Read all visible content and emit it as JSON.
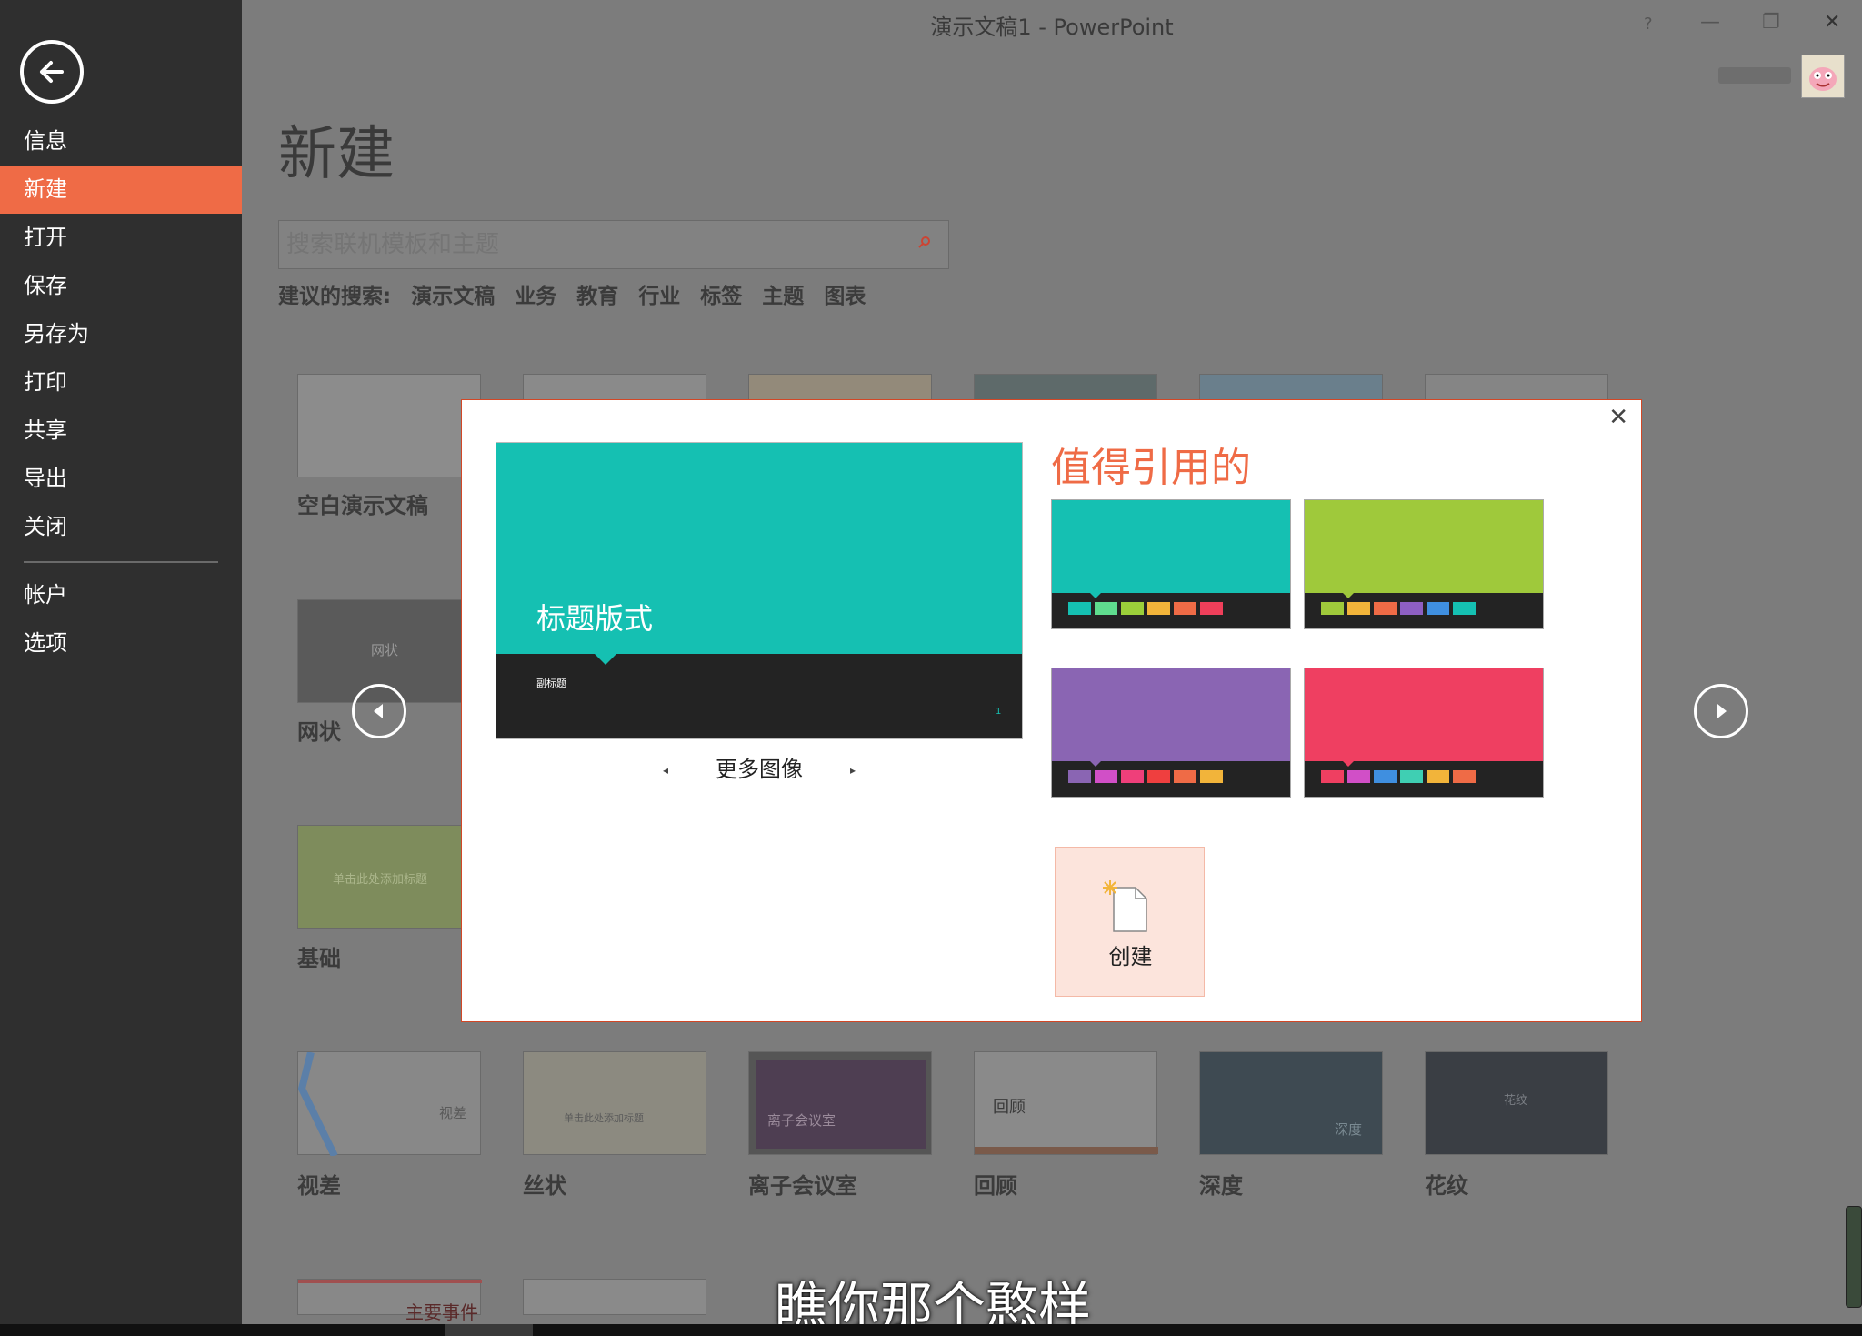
{
  "window": {
    "title": "演示文稿1 - PowerPoint",
    "help": "?",
    "minimize": "—",
    "maximize": "❐",
    "close": "✕"
  },
  "sidebar": {
    "items": [
      {
        "label": "信息"
      },
      {
        "label": "新建"
      },
      {
        "label": "打开"
      },
      {
        "label": "保存"
      },
      {
        "label": "另存为"
      },
      {
        "label": "打印"
      },
      {
        "label": "共享"
      },
      {
        "label": "导出"
      },
      {
        "label": "关闭"
      },
      {
        "label": "帐户"
      },
      {
        "label": "选项"
      }
    ],
    "active_index": 1
  },
  "main": {
    "heading": "新建",
    "search": {
      "placeholder": "搜索联机模板和主题"
    },
    "suggested": {
      "label": "建议的搜索:",
      "items": [
        "演示文稿",
        "业务",
        "教育",
        "行业",
        "标签",
        "主题",
        "图表"
      ]
    },
    "templates": {
      "blank": "空白演示文稿",
      "mesh": "网状",
      "mesh_inner": "网状",
      "basis": "基础",
      "basis_inner": "单击此处添加标题",
      "parallax": "视差",
      "parallax_inner": "视差",
      "wisp": "丝状",
      "wisp_inner": "单击此处添加标题",
      "ion_boardroom": "离子会议室",
      "ion_boardroom_inner": "离子会议室",
      "retrospect": "回顾",
      "retrospect_inner": "回顾",
      "depth": "深度",
      "depth_inner": "深度",
      "vapor": "花纹",
      "vapor_inner": "花纹",
      "partial_inner": "主要事件"
    }
  },
  "modal": {
    "close": "✕",
    "preview": {
      "title": "标题版式",
      "subtitle": "副标题",
      "page_number": "1"
    },
    "more_images": "更多图像",
    "prev_arrow": "◂",
    "next_arrow": "▸",
    "heading": "值得引用的",
    "variants": [
      {
        "color": "#15c0b2",
        "swatches": [
          "#15c0b2",
          "#5fdc8e",
          "#9bcf3a",
          "#f2b43a",
          "#ef6b46",
          "#ef3f5a"
        ]
      },
      {
        "color": "#9fc93b",
        "swatches": [
          "#9fc93b",
          "#f2b43a",
          "#ef6b46",
          "#8d5fc2",
          "#3f8fe0",
          "#15c0b2"
        ]
      },
      {
        "color": "#8a65b3",
        "swatches": [
          "#8a65b3",
          "#d14fc7",
          "#ef3f7a",
          "#ef3f3f",
          "#ef6b46",
          "#f2b43a"
        ]
      },
      {
        "color": "#ef3f61",
        "swatches": [
          "#ef3f61",
          "#d14fc7",
          "#3f8fe0",
          "#3fcfb3",
          "#f2b43a",
          "#ef6b46"
        ]
      }
    ],
    "create_label": "创建"
  },
  "overlay": {
    "subtitle": "瞧你那个憨样"
  }
}
